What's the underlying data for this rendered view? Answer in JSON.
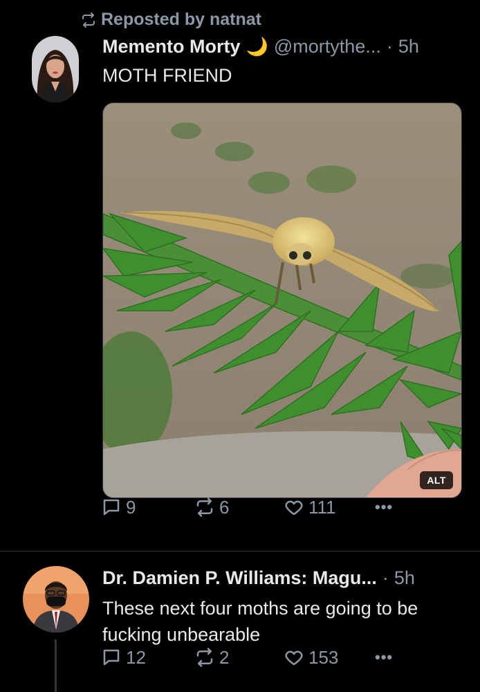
{
  "post1": {
    "repost_label": "Reposted by natnat",
    "display_name": "Memento Morty",
    "name_emoji": "🌙",
    "handle": "@mortythe...",
    "separator": "·",
    "time": "5h",
    "text": "MOTH FRIEND",
    "alt_label": "ALT",
    "replies": "9",
    "reposts": "6",
    "likes": "111"
  },
  "post2": {
    "display_name": "Dr. Damien P. Williams: Magu...",
    "separator": "·",
    "time": "5h",
    "text": "These next four moths are going to be fucking unbearable",
    "replies": "12",
    "reposts": "2",
    "likes": "153"
  },
  "icons": {
    "repost": "repost-icon",
    "reply": "reply-icon",
    "like": "heart-icon",
    "more": "more-icon"
  },
  "colors": {
    "background": "#000000",
    "text": "#e7e9ea",
    "muted": "#8b98a5",
    "divider": "#2f3336"
  }
}
